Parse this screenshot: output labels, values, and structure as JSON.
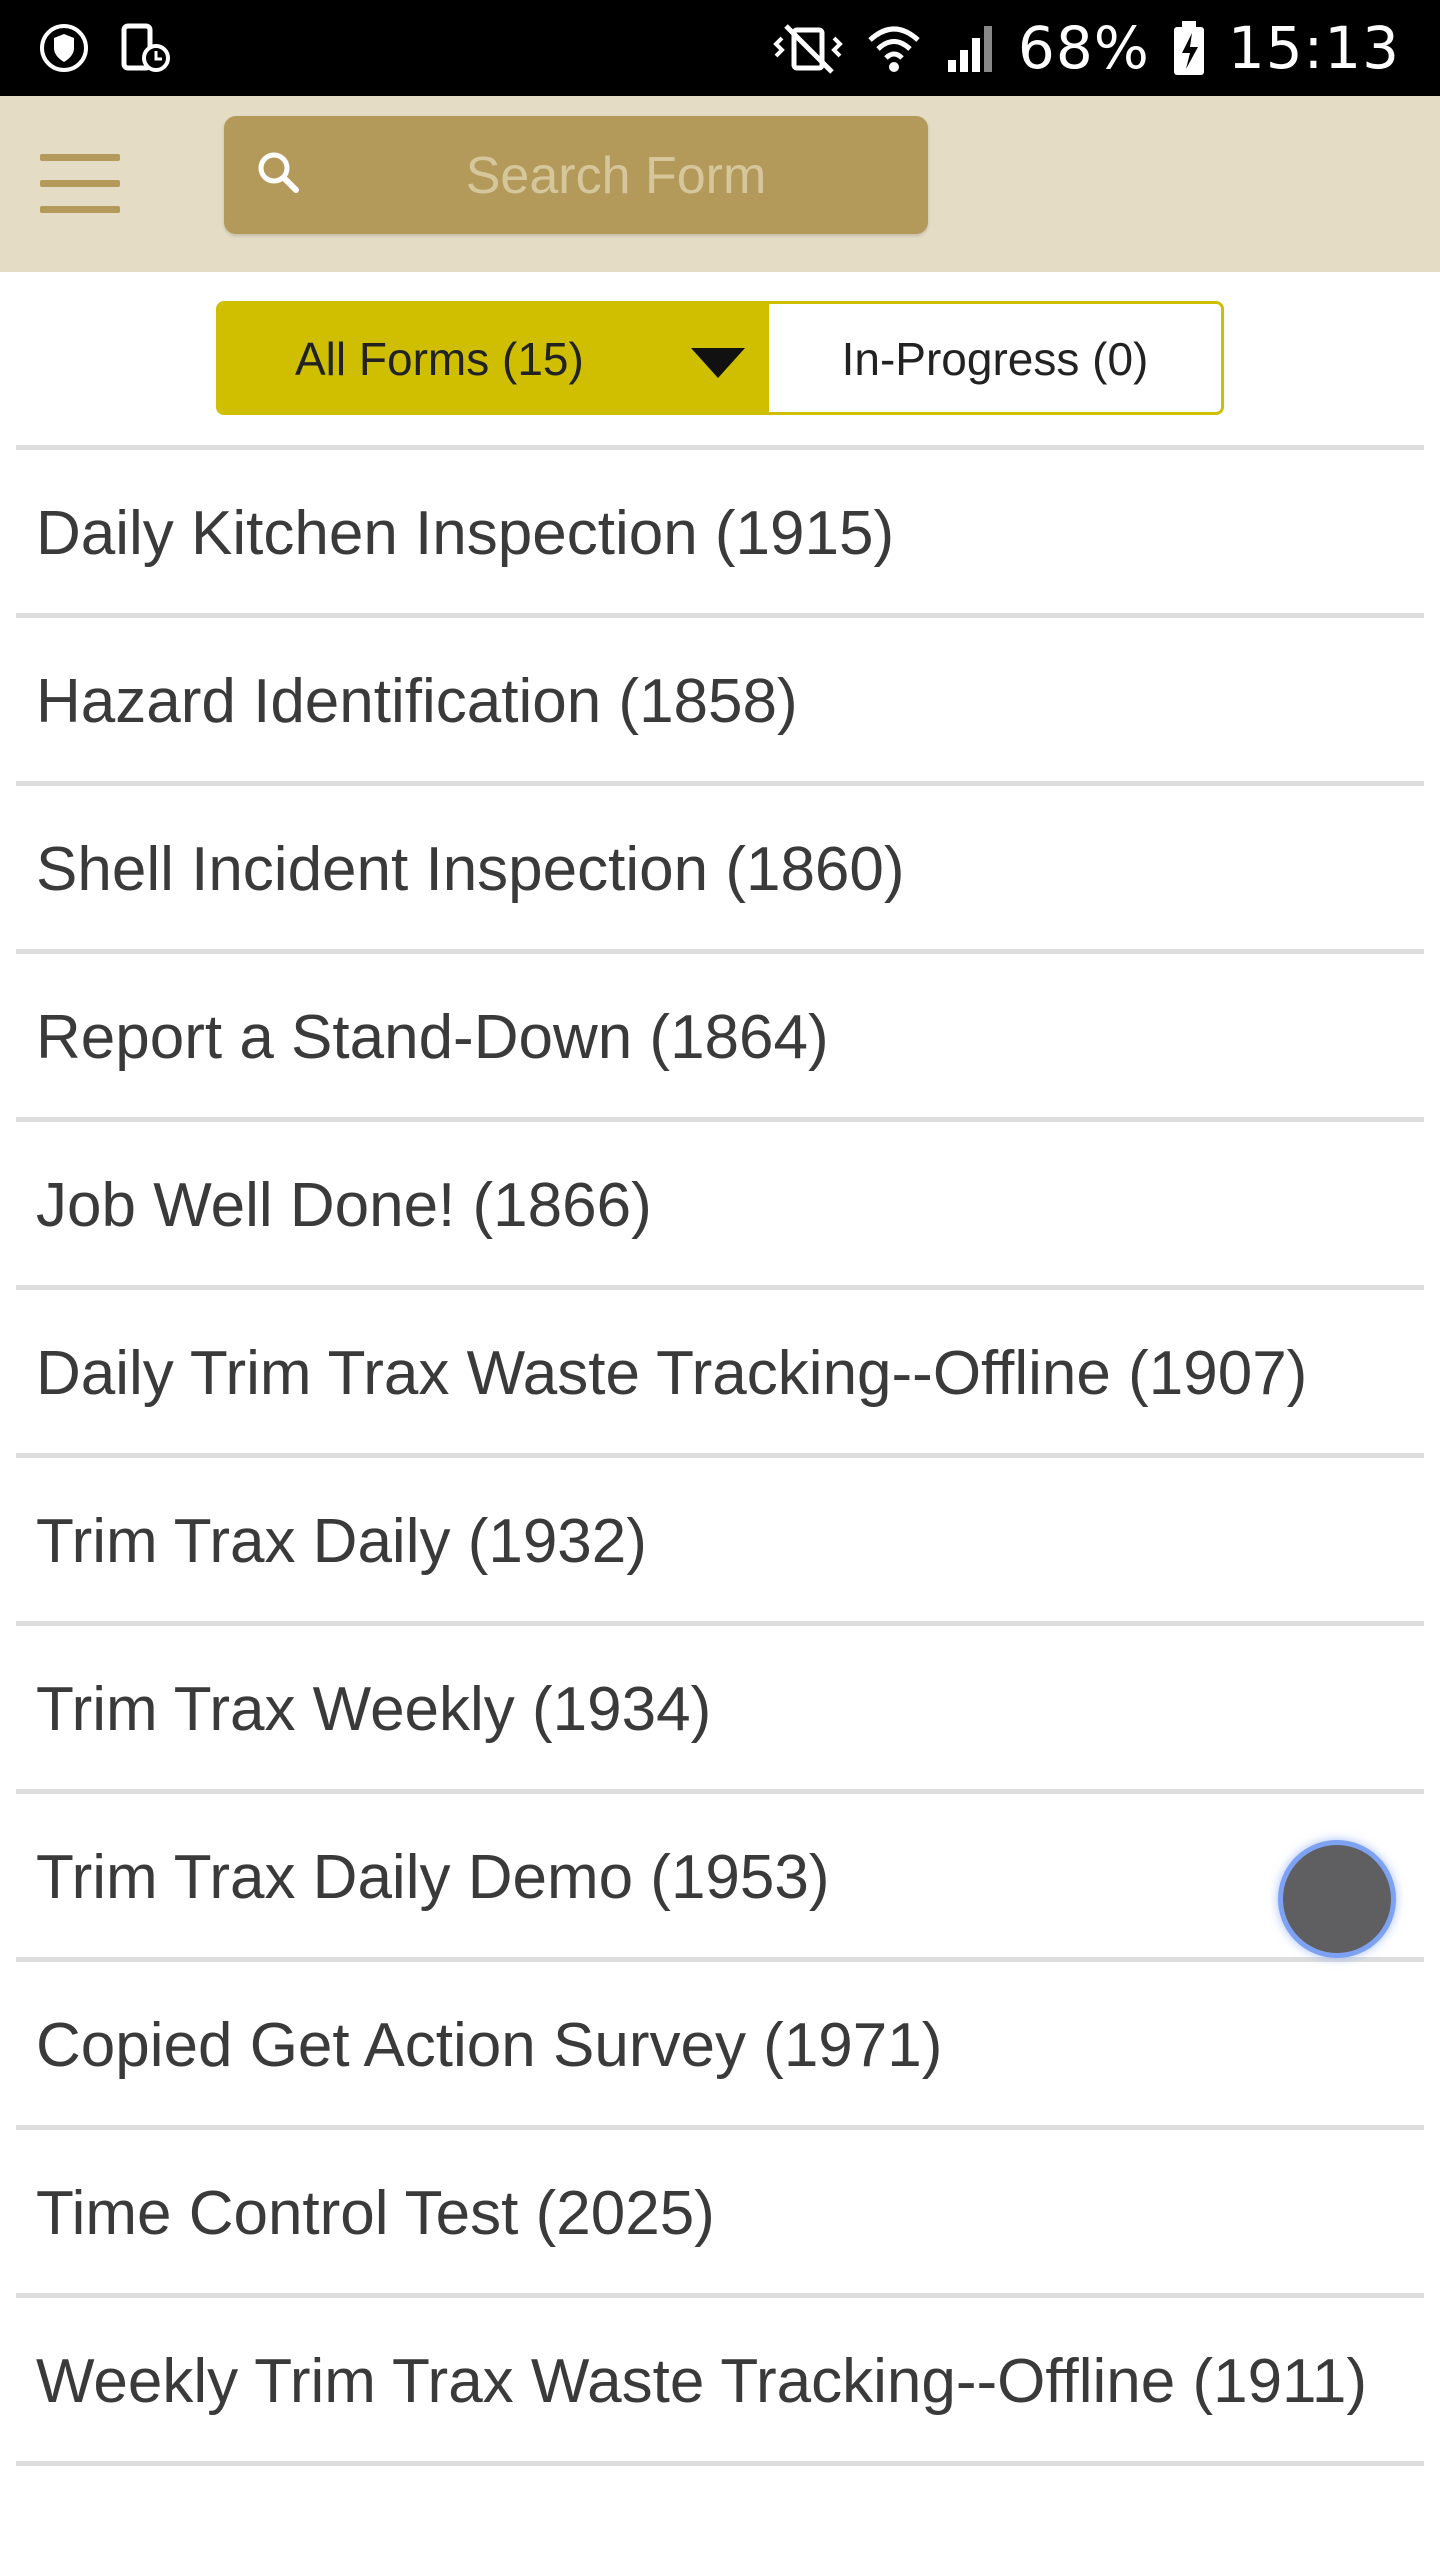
{
  "status_bar": {
    "battery": "68%",
    "time": "15:13",
    "icons": [
      "shield-icon",
      "phone-device-icon",
      "vibrate-mute-icon",
      "wifi-icon",
      "cellular-signal-icon",
      "battery-charging-icon"
    ]
  },
  "header": {
    "menu_icon": "hamburger-icon",
    "search": {
      "placeholder": "Search Form",
      "value": "",
      "icon": "search-icon"
    },
    "colors": {
      "background": "#e5dcc5",
      "accent": "#b39a5a"
    }
  },
  "tabs": {
    "all_forms": {
      "label": "All Forms (15)",
      "selected": true,
      "icon": "caret-down-icon"
    },
    "in_progress": {
      "label": "In-Progress (0)",
      "selected": false
    },
    "colors": {
      "active": "#cfbf00"
    }
  },
  "forms": [
    {
      "label": "Daily Kitchen Inspection (1915)"
    },
    {
      "label": "Hazard Identification (1858)"
    },
    {
      "label": "Shell Incident Inspection (1860)"
    },
    {
      "label": "Report a Stand-Down (1864)"
    },
    {
      "label": "Job Well Done! (1866)"
    },
    {
      "label": "Daily Trim Trax Waste Tracking--Offline (1907)"
    },
    {
      "label": "Trim Trax Daily (1932)"
    },
    {
      "label": "Trim Trax Weekly (1934)"
    },
    {
      "label": "Trim Trax Daily Demo (1953)"
    },
    {
      "label": "Copied Get Action Survey (1971)"
    },
    {
      "label": "Time Control Test (2025)"
    },
    {
      "label": "Weekly Trim Trax Waste Tracking--Offline (1911)"
    }
  ],
  "floating_button": {
    "icon": "assistive-touch-icon",
    "color": "#5f5f62",
    "ring_color": "#7da2f4"
  }
}
